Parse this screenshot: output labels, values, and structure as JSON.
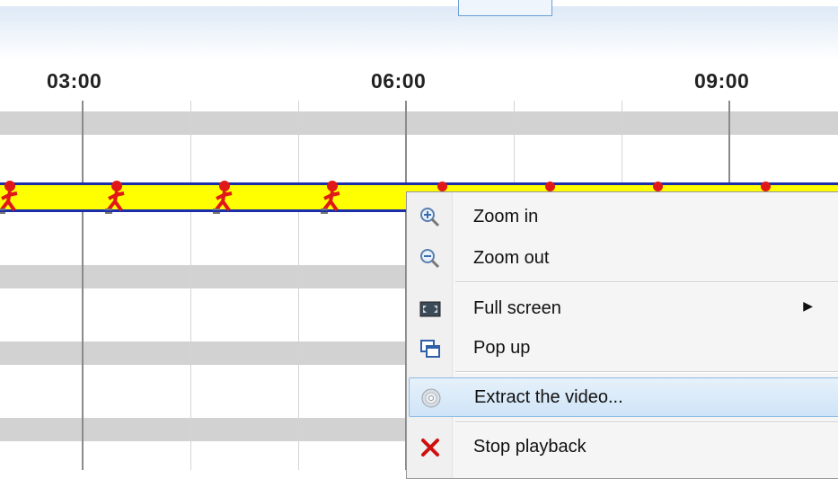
{
  "timeline": {
    "tick_labels": [
      "03:00",
      "06:00",
      "09:00"
    ]
  },
  "context_menu": {
    "items": [
      {
        "label": "Zoom in",
        "icon": "zoom-in-icon"
      },
      {
        "label": "Zoom out",
        "icon": "zoom-out-icon"
      },
      {
        "label": "Full screen",
        "icon": "full-screen-icon",
        "has_submenu": true
      },
      {
        "label": "Pop up",
        "icon": "pop-up-icon"
      },
      {
        "label": "Extract the video...",
        "icon": "disc-icon",
        "highlighted": true
      },
      {
        "label": "Stop playback",
        "icon": "close-icon"
      }
    ]
  },
  "colors": {
    "track_fill": "#ffff00",
    "track_border": "#1c2fa8",
    "marker": "#e01818",
    "menu_highlight": "#cfe4f7",
    "stop_icon": "#d01010"
  }
}
